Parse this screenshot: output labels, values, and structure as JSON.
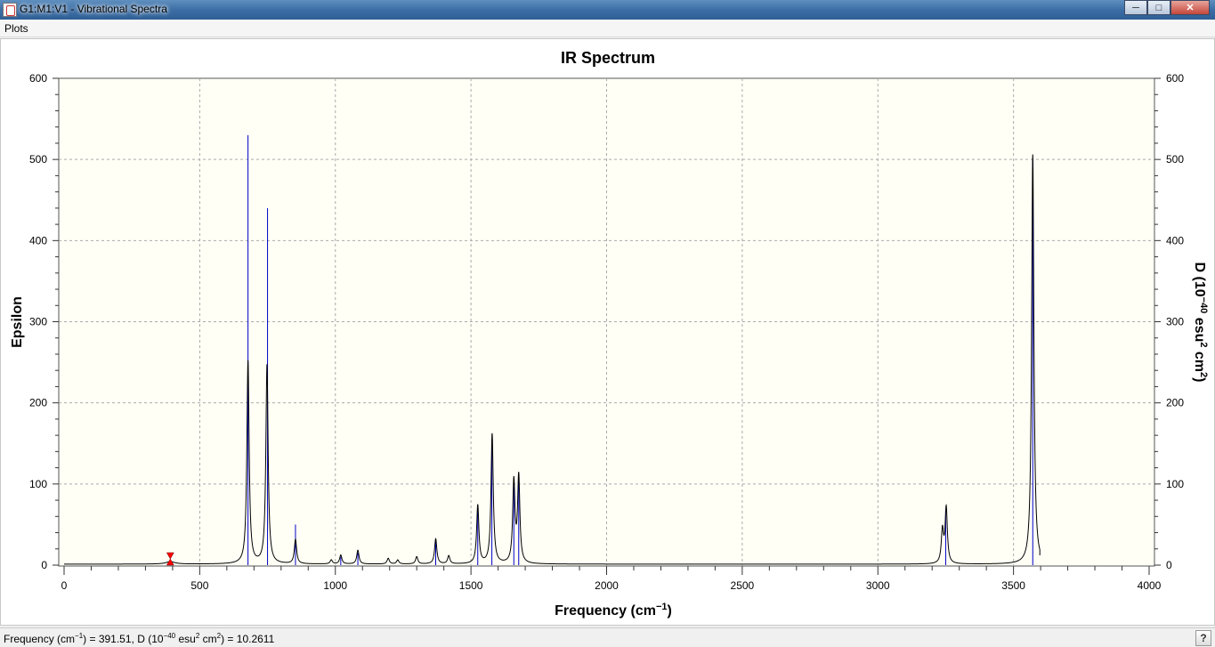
{
  "window": {
    "title": "G1:M1:V1 - Vibrational Spectra",
    "controls": [
      "minimize",
      "maximize",
      "close"
    ]
  },
  "menu": {
    "items": [
      "Plots"
    ]
  },
  "status": {
    "text": "Frequency (cm-1) = 391.51, D (10-40 esu2 cm2) = 10.2611",
    "help_icon": "question-mark-icon"
  },
  "colors": {
    "spectrum_line": "#000000",
    "stick_line": "#0000c8",
    "plot_bg": "#fffff6",
    "marker": "#ff0000"
  },
  "chart_data": {
    "type": "line",
    "title": "IR Spectrum",
    "xlabel": "Frequency (cm-1)",
    "ylabel": "Epsilon",
    "y2label": "D (10-40 esu2 cm2)",
    "xlim": [
      0,
      4000
    ],
    "ylim": [
      0,
      600
    ],
    "y2lim": [
      0,
      600
    ],
    "x_ticks": [
      "0",
      "500",
      "1000",
      "1500",
      "2000",
      "2500",
      "3000",
      "3500",
      "4000"
    ],
    "y_ticks": [
      "0",
      "100",
      "200",
      "300",
      "400",
      "500",
      "600"
    ],
    "grid": true,
    "cursor_marker_x": 391.51,
    "series": [
      {
        "kind": "stick",
        "peaks": [
          {
            "x": 678,
            "y": 530
          },
          {
            "x": 750,
            "y": 440
          },
          {
            "x": 853,
            "y": 50
          },
          {
            "x": 1020,
            "y": 10
          },
          {
            "x": 1083,
            "y": 15
          },
          {
            "x": 1370,
            "y": 30
          },
          {
            "x": 1525,
            "y": 70
          },
          {
            "x": 1577,
            "y": 155
          },
          {
            "x": 1658,
            "y": 100
          },
          {
            "x": 1676,
            "y": 105
          },
          {
            "x": 3250,
            "y": 67
          },
          {
            "x": 3571,
            "y": 500
          }
        ]
      },
      {
        "kind": "envelope",
        "x_end": 3597,
        "peaks": [
          {
            "x": 392,
            "y": 3,
            "w": 20
          },
          {
            "x": 678,
            "y": 250,
            "w": 5
          },
          {
            "x": 748,
            "y": 245,
            "w": 5
          },
          {
            "x": 853,
            "y": 30,
            "w": 5
          },
          {
            "x": 985,
            "y": 5,
            "w": 5
          },
          {
            "x": 1020,
            "y": 11,
            "w": 5
          },
          {
            "x": 1083,
            "y": 17,
            "w": 5
          },
          {
            "x": 1195,
            "y": 7,
            "w": 5
          },
          {
            "x": 1230,
            "y": 5,
            "w": 5
          },
          {
            "x": 1300,
            "y": 9,
            "w": 5
          },
          {
            "x": 1370,
            "y": 31,
            "w": 5
          },
          {
            "x": 1418,
            "y": 10,
            "w": 5
          },
          {
            "x": 1525,
            "y": 72,
            "w": 5
          },
          {
            "x": 1578,
            "y": 160,
            "w": 5
          },
          {
            "x": 1658,
            "y": 100,
            "w": 5
          },
          {
            "x": 1676,
            "y": 106,
            "w": 5
          },
          {
            "x": 3238,
            "y": 40,
            "w": 5
          },
          {
            "x": 3252,
            "y": 68,
            "w": 5
          },
          {
            "x": 3571,
            "y": 505,
            "w": 5
          }
        ]
      }
    ]
  }
}
